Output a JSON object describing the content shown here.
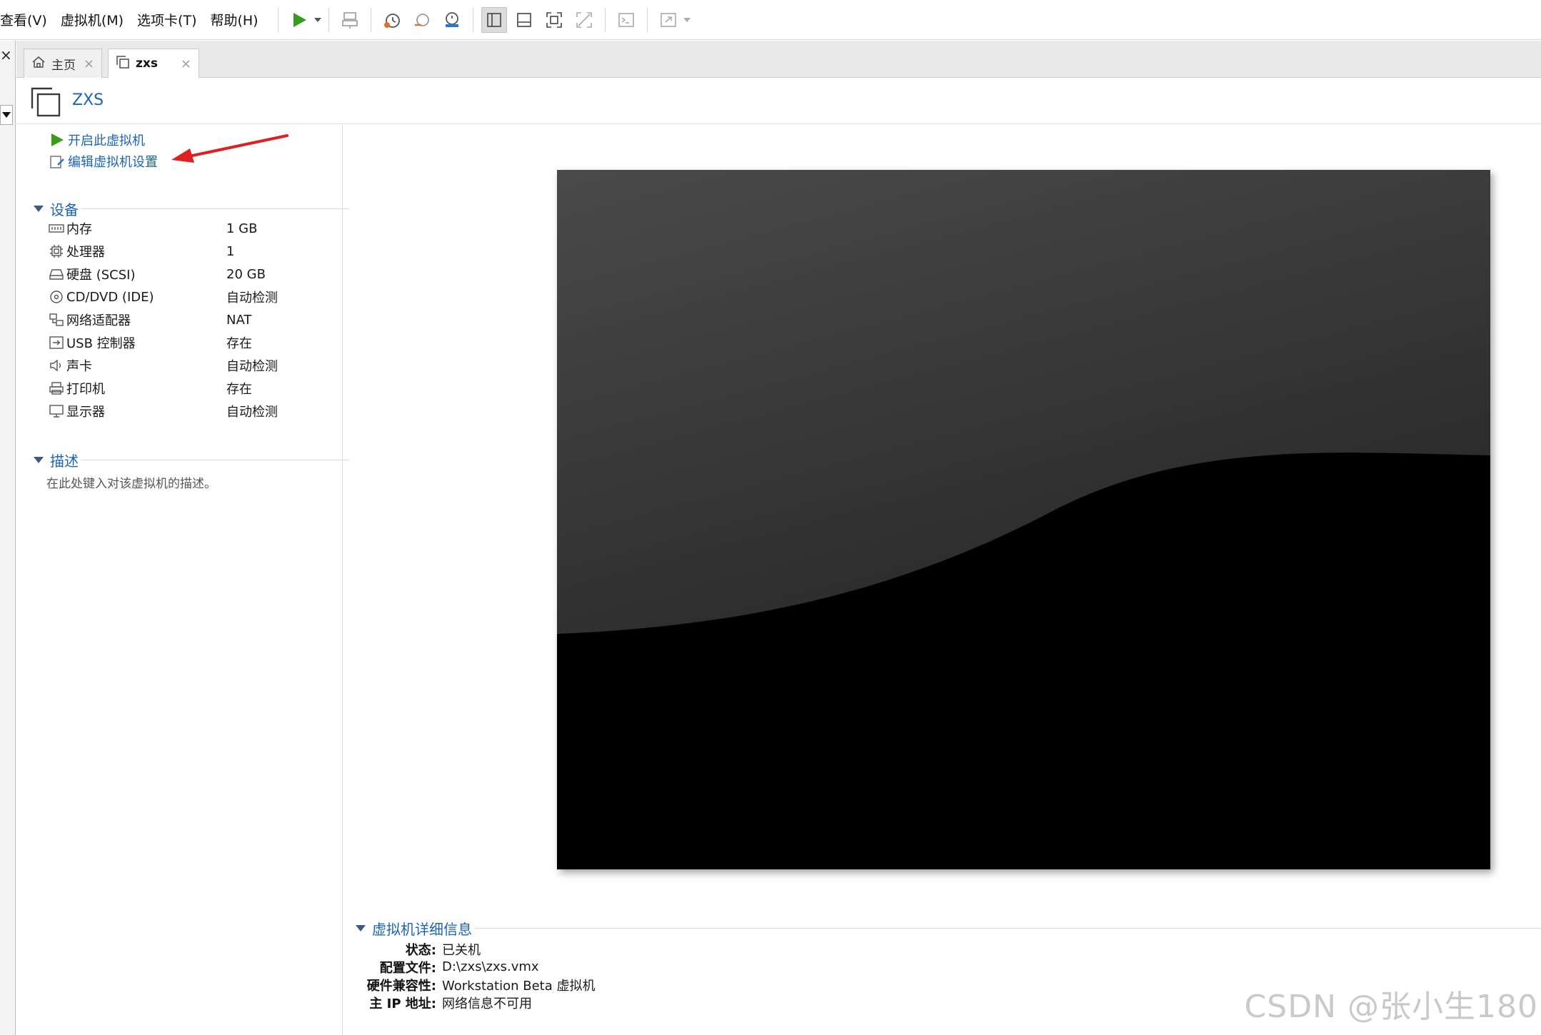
{
  "menu": [
    "查看(V)",
    "虚拟机(M)",
    "选项卡(T)",
    "帮助(H)"
  ],
  "toolbar": {
    "icons": [
      "play-icon",
      "dropdown-caret-icon",
      "send-keys-icon",
      "snapshot-icon",
      "revert-snapshot-icon",
      "snapshot-manager-icon",
      "library-view-icon",
      "thumbnail-view-icon",
      "fullscreen-icon",
      "unity-icon",
      "console-icon",
      "stretch-icon"
    ]
  },
  "sidebar": {
    "close": "×"
  },
  "tabs": [
    {
      "label": "主页",
      "close": "×"
    },
    {
      "label": "zxs",
      "close": "×"
    }
  ],
  "vm": {
    "title": "ZXS",
    "actions": {
      "start": "开启此虚拟机",
      "edit": "编辑虚拟机设置"
    },
    "devices_heading": "设备",
    "devices": [
      {
        "name": "内存",
        "value": "1 GB",
        "icon": "memory-icon"
      },
      {
        "name": "处理器",
        "value": "1",
        "icon": "cpu-icon"
      },
      {
        "name": "硬盘 (SCSI)",
        "value": "20 GB",
        "icon": "hard-disk-icon"
      },
      {
        "name": "CD/DVD (IDE)",
        "value": "自动检测",
        "icon": "cd-dvd-icon"
      },
      {
        "name": "网络适配器",
        "value": "NAT",
        "icon": "network-adapter-icon"
      },
      {
        "name": "USB 控制器",
        "value": "存在",
        "icon": "usb-icon"
      },
      {
        "name": "声卡",
        "value": "自动检测",
        "icon": "sound-card-icon"
      },
      {
        "name": "打印机",
        "value": "存在",
        "icon": "printer-icon"
      },
      {
        "name": "显示器",
        "value": "自动检测",
        "icon": "display-icon"
      }
    ],
    "description_heading": "描述",
    "description_placeholder": "在此处键入对该虚拟机的描述。",
    "details_heading": "虚拟机详细信息",
    "details": [
      {
        "key": "状态:",
        "value": "已关机"
      },
      {
        "key": "配置文件:",
        "value": "D:\\zxs\\zxs.vmx"
      },
      {
        "key": "硬件兼容性:",
        "value": "Workstation Beta 虚拟机"
      },
      {
        "key": "主 IP 地址:",
        "value": "网络信息不可用"
      }
    ]
  },
  "colors": {
    "link": "#1c63b7",
    "play": "#3a9a1c",
    "annotation": "#e02020"
  },
  "watermark": "CSDN @张小生180"
}
